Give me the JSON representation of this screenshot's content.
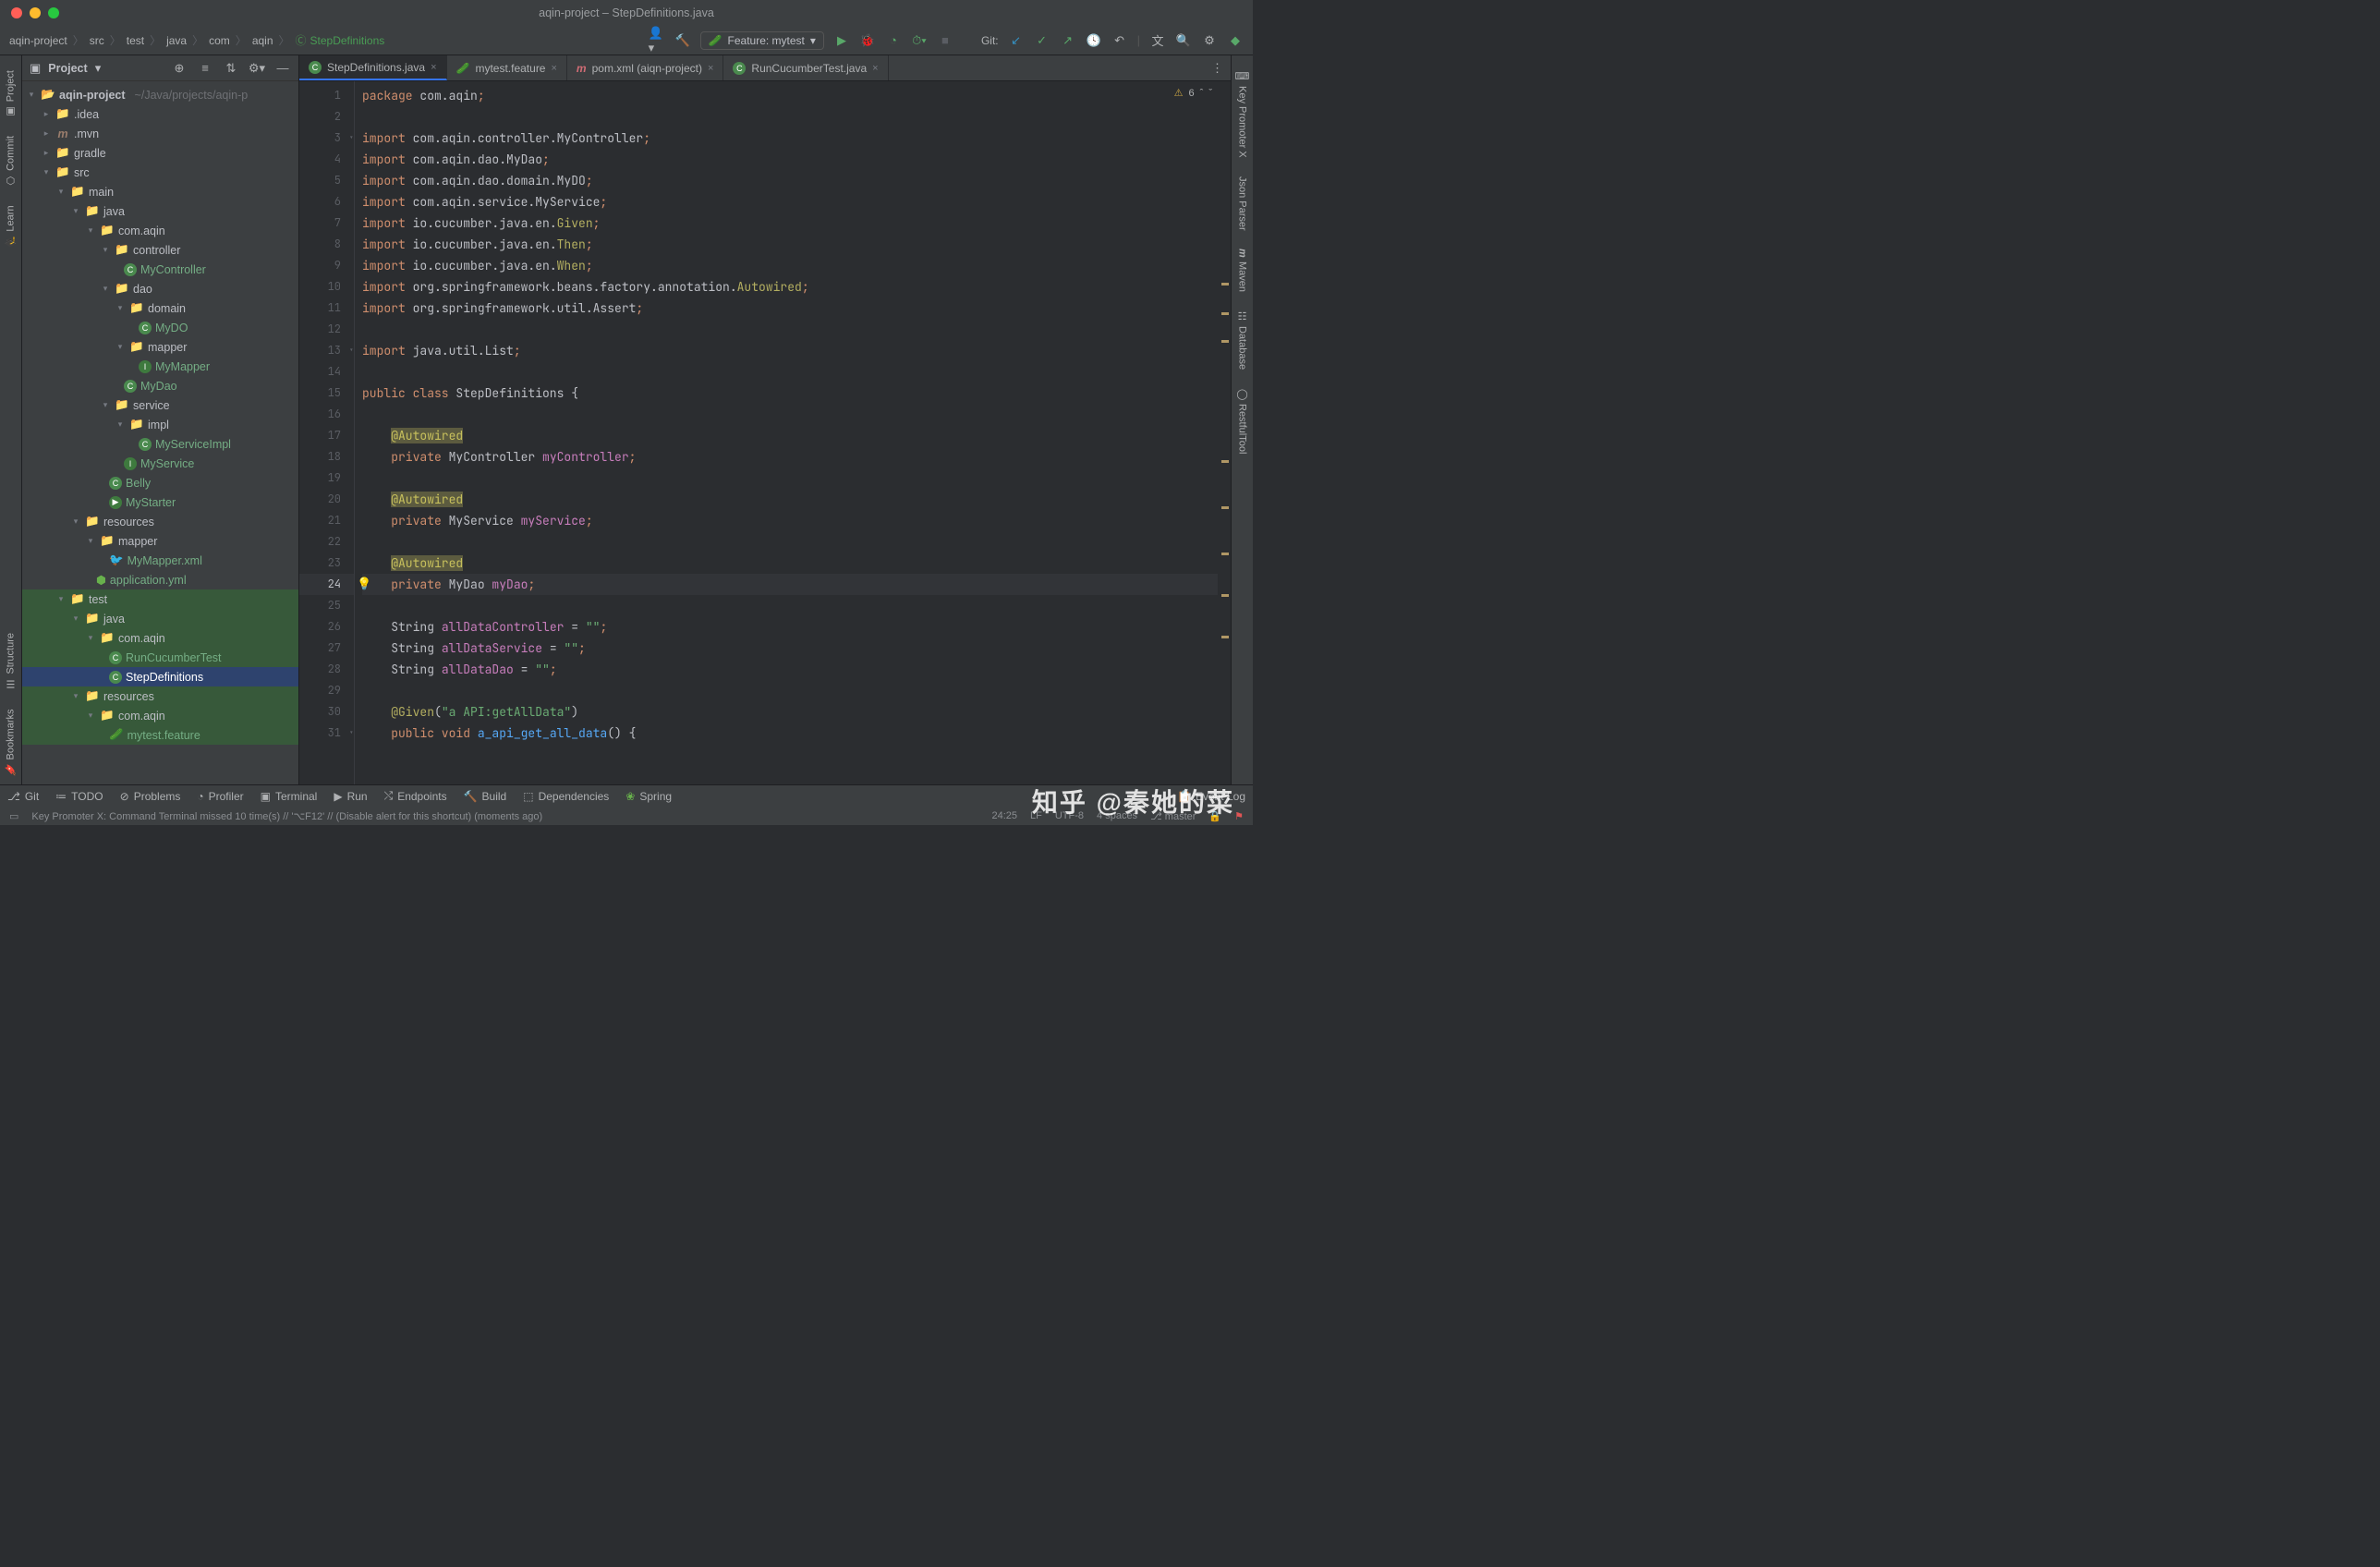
{
  "window": {
    "title": "aqin-project – StepDefinitions.java"
  },
  "breadcrumb": [
    "aqin-project",
    "src",
    "test",
    "java",
    "com",
    "aqin",
    "StepDefinitions"
  ],
  "runConfig": {
    "label": "Feature: mytest"
  },
  "gitLabel": "Git:",
  "leftGutter": {
    "project": "Project",
    "commit": "Commit",
    "learn": "Learn",
    "structure": "Structure",
    "bookmarks": "Bookmarks"
  },
  "rightGutter": {
    "keypromoter": "Key Promoter X",
    "jsonparser": "Json Parser",
    "maven": "Maven",
    "database": "Database",
    "restful": "RestfulTool"
  },
  "projectPanel": {
    "title": "Project"
  },
  "tree": {
    "root": {
      "name": "aqin-project",
      "path": "~/Java/projects/aqin-p"
    },
    "idea": ".idea",
    "mvn": ".mvn",
    "gradle": "gradle",
    "src": "src",
    "main": "main",
    "java1": "java",
    "pkg1": "com.aqin",
    "controller": "controller",
    "mycontroller": "MyController",
    "dao": "dao",
    "domain": "domain",
    "mydo": "MyDO",
    "mapper": "mapper",
    "mymapper": "MyMapper",
    "mydao": "MyDao",
    "service": "service",
    "impl": "impl",
    "myserviceimpl": "MyServiceImpl",
    "myservice": "MyService",
    "belly": "Belly",
    "mystarter": "MyStarter",
    "resources1": "resources",
    "mapper2": "mapper",
    "mymapperxml": "MyMapper.xml",
    "appyml": "application.yml",
    "test": "test",
    "java2": "java",
    "pkg2": "com.aqin",
    "runcuke": "RunCucumberTest",
    "stepdef": "StepDefinitions",
    "resources2": "resources",
    "pkg3": "com.aqin",
    "mytestfeature": "mytest.feature"
  },
  "tabs": [
    {
      "label": "StepDefinitions.java",
      "type": "class",
      "active": true
    },
    {
      "label": "mytest.feature",
      "type": "cuke"
    },
    {
      "label": "pom.xml (aiqn-project)",
      "type": "maven"
    },
    {
      "label": "RunCucumberTest.java",
      "type": "class"
    }
  ],
  "inspections": {
    "warnings": "6"
  },
  "code": {
    "l1": [
      "package",
      " com.aqin",
      ";"
    ],
    "l3": [
      "import",
      " com.aqin.controller.MyController",
      ";"
    ],
    "l4": [
      "import",
      " com.aqin.dao.MyDao",
      ";"
    ],
    "l5": [
      "import",
      " com.aqin.dao.domain.MyDO",
      ";"
    ],
    "l6": [
      "import",
      " com.aqin.service.MyService",
      ";"
    ],
    "l7": [
      "import",
      " io.cucumber.java.en.",
      "Given",
      ";"
    ],
    "l8": [
      "import",
      " io.cucumber.java.en.",
      "Then",
      ";"
    ],
    "l9": [
      "import",
      " io.cucumber.java.en.",
      "When",
      ";"
    ],
    "l10": [
      "import",
      " org.springframework.beans.factory.annotation.",
      "Autowired",
      ";"
    ],
    "l11": [
      "import",
      " org.springframework.util.Assert",
      ";"
    ],
    "l13": [
      "import",
      " java.util.List",
      ";"
    ],
    "l15": [
      "public class",
      " StepDefinitions ",
      "{"
    ],
    "l17": "@Autowired",
    "l18": [
      "private",
      " MyController ",
      "myController",
      ";"
    ],
    "l20": "@Autowired",
    "l21": [
      "private",
      " MyService ",
      "myService",
      ";"
    ],
    "l23": "@Autowired",
    "l24": [
      "private",
      " MyDao ",
      "myDao",
      ";"
    ],
    "l26": [
      "String ",
      "allDataController",
      " = ",
      "\"\"",
      ";"
    ],
    "l27": [
      "String ",
      "allDataService",
      " = ",
      "\"\"",
      ";"
    ],
    "l28": [
      "String ",
      "allDataDao",
      " = ",
      "\"\"",
      ";"
    ],
    "l30": [
      "@Given",
      "(",
      "\"a API:getAllData\"",
      ")"
    ],
    "l31": [
      "public void",
      " ",
      "a_api_get_all_data",
      "() ",
      "{"
    ]
  },
  "bottomBar": {
    "git": "Git",
    "todo": "TODO",
    "problems": "Problems",
    "profiler": "Profiler",
    "terminal": "Terminal",
    "run": "Run",
    "endpoints": "Endpoints",
    "build": "Build",
    "dependencies": "Dependencies",
    "spring": "Spring",
    "eventlog": "Event Log"
  },
  "statusBar": {
    "message": "Key Promoter X: Command Terminal missed 10 time(s) // '⌥F12' // (Disable alert for this shortcut) (moments ago)",
    "pos": "24:25",
    "sep": "LF",
    "enc": "UTF-8",
    "indent": "4 spaces",
    "branch": "master"
  },
  "watermark": "知乎 @秦她的菜"
}
